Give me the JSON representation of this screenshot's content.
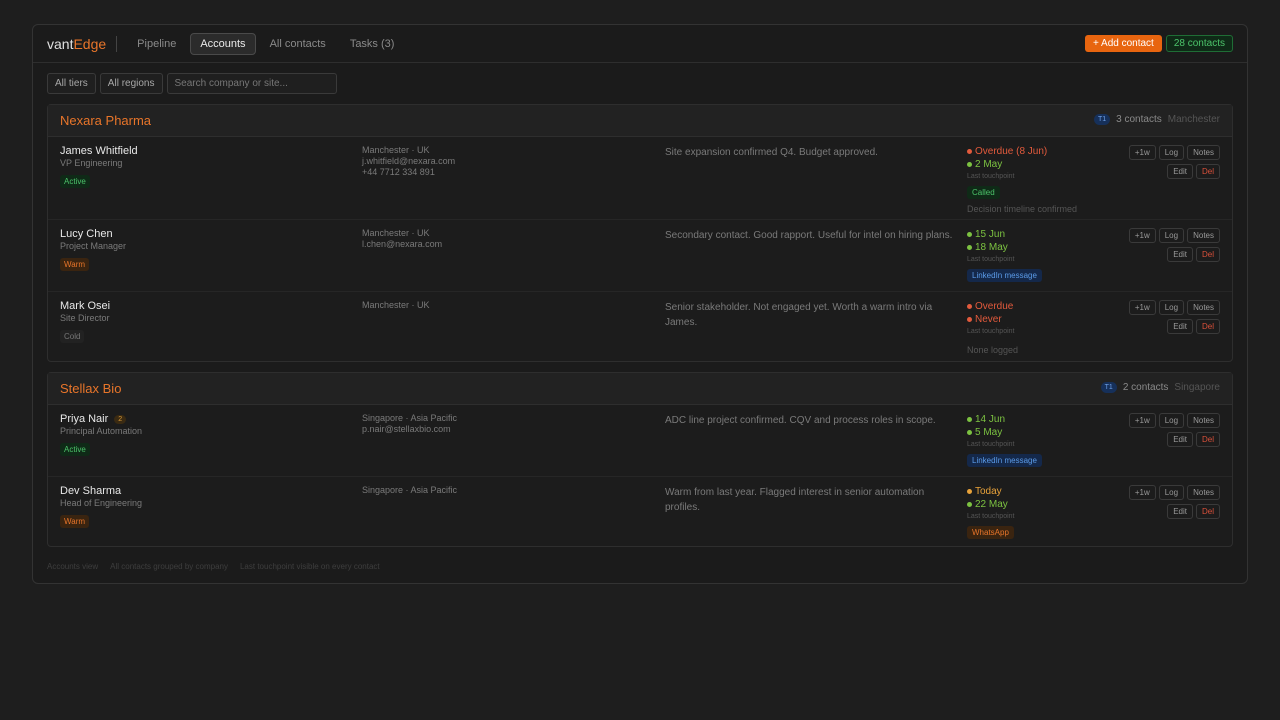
{
  "brand": {
    "part1": "vant",
    "part2": "Edge"
  },
  "nav": [
    {
      "label": "Pipeline"
    },
    {
      "label": "Accounts"
    },
    {
      "label": "All contacts"
    },
    {
      "label": "Tasks (3)"
    }
  ],
  "header": {
    "add_label": "+ Add contact",
    "count_label": "28 contacts"
  },
  "filters": {
    "tiers": "All tiers",
    "regions": "All regions",
    "search_placeholder": "Search company or site..."
  },
  "actions": {
    "plus1w": "+1w",
    "log": "Log",
    "notes": "Notes",
    "edit": "Edit",
    "del": "Del"
  },
  "companies": [
    {
      "name": "Nexara Pharma",
      "tier": "T1",
      "count": "3 contacts",
      "city": "Manchester",
      "contacts": [
        {
          "name": "James Whitfield",
          "title": "VP Engineering",
          "status": "Active",
          "location": "Manchester · UK",
          "email": "j.whitfield@nexara.com",
          "phone": "+44 7712 334 891",
          "notes": "Site expansion confirmed Q4. Budget approved.",
          "next": "Overdue (8 Jun)",
          "last": "2 May",
          "tp_label": "Last touchpoint",
          "channel": "Called",
          "tp_note": "Decision timeline confirmed"
        },
        {
          "name": "Lucy Chen",
          "title": "Project Manager",
          "status": "Warm",
          "location": "Manchester · UK",
          "email": "l.chen@nexara.com",
          "notes": "Secondary contact. Good rapport. Useful for intel on hiring plans.",
          "next": "15 Jun",
          "last": "18 May",
          "tp_label": "Last touchpoint",
          "channel": "LinkedIn message"
        },
        {
          "name": "Mark Osei",
          "title": "Site Director",
          "status": "Cold",
          "location": "Manchester · UK",
          "notes": "Senior stakeholder. Not engaged yet. Worth a warm intro via James.",
          "next": "Overdue",
          "last": "Never",
          "tp_label": "Last touchpoint",
          "tp_note": "None logged"
        }
      ]
    },
    {
      "name": "Stellax Bio",
      "tier": "T1",
      "count": "2 contacts",
      "city": "Singapore",
      "contacts": [
        {
          "name": "Priya Nair",
          "badge": "2",
          "title": "Principal Automation",
          "status": "Active",
          "location": "Singapore · Asia Pacific",
          "email": "p.nair@stellaxbio.com",
          "notes": "ADC line project confirmed. CQV and process roles in scope.",
          "next": "14 Jun",
          "last": "5 May",
          "tp_label": "Last touchpoint",
          "channel": "LinkedIn message"
        },
        {
          "name": "Dev Sharma",
          "title": "Head of Engineering",
          "status": "Warm",
          "location": "Singapore · Asia Pacific",
          "notes": "Warm from last year. Flagged interest in senior automation profiles.",
          "next": "Today",
          "last": "22 May",
          "tp_label": "Last touchpoint",
          "channel": "WhatsApp"
        }
      ]
    }
  ],
  "footer": [
    "Accounts view",
    "All contacts grouped by company",
    "Last touchpoint visible on every contact"
  ]
}
